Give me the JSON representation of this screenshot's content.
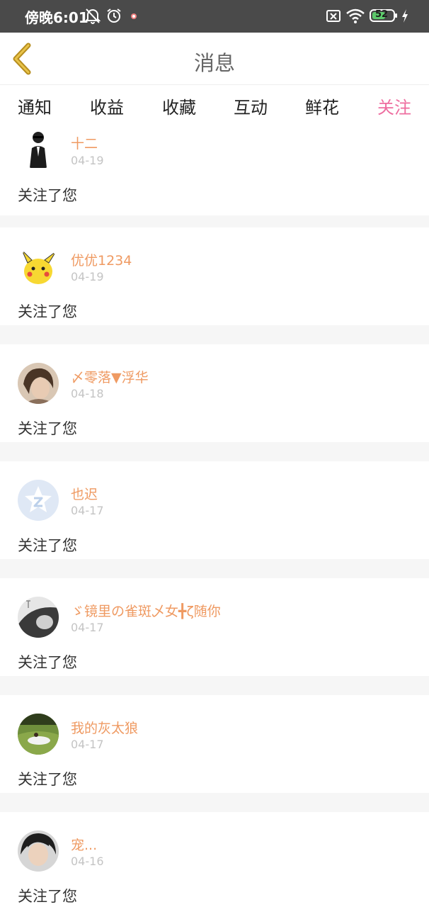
{
  "statusbar": {
    "time": "傍晚6:01",
    "battery": "52",
    "icons": [
      "bell-off-icon",
      "alarm-icon",
      "notification-dot-icon",
      "sim-disabled-icon",
      "wifi-icon",
      "battery-icon",
      "charging-icon"
    ]
  },
  "header": {
    "title": "消息",
    "back_icon": "chevron-left-icon",
    "accent_color": "#ee6ea0",
    "back_color": "#c9a227"
  },
  "tabs": [
    {
      "label": "通知"
    },
    {
      "label": "收益"
    },
    {
      "label": "收藏"
    },
    {
      "label": "互动"
    },
    {
      "label": "鲜花"
    },
    {
      "label": "关注",
      "active": true
    }
  ],
  "items": [
    {
      "name": "十二",
      "date": "04-19",
      "message": "关注了您",
      "avatar": "suit-figure-avatar"
    },
    {
      "name": "优优1234",
      "date": "04-19",
      "message": "关注了您",
      "avatar": "pikachu-avatar"
    },
    {
      "name": "〆零落▼浮华",
      "date": "04-18",
      "message": "关注了您",
      "avatar": "photo-avatar"
    },
    {
      "name": "也迟",
      "date": "04-17",
      "message": "关注了您",
      "avatar": "default-star-avatar"
    },
    {
      "name": "ゞ镜里の雀斑乄女╋ζ随你",
      "date": "04-17",
      "message": "关注了您",
      "avatar": "photo-avatar"
    },
    {
      "name": "我的灰太狼",
      "date": "04-17",
      "message": "关注了您",
      "avatar": "landscape-avatar"
    },
    {
      "name": "宠...",
      "date": "04-16",
      "message": "关注了您",
      "avatar": "portrait-avatar"
    }
  ]
}
